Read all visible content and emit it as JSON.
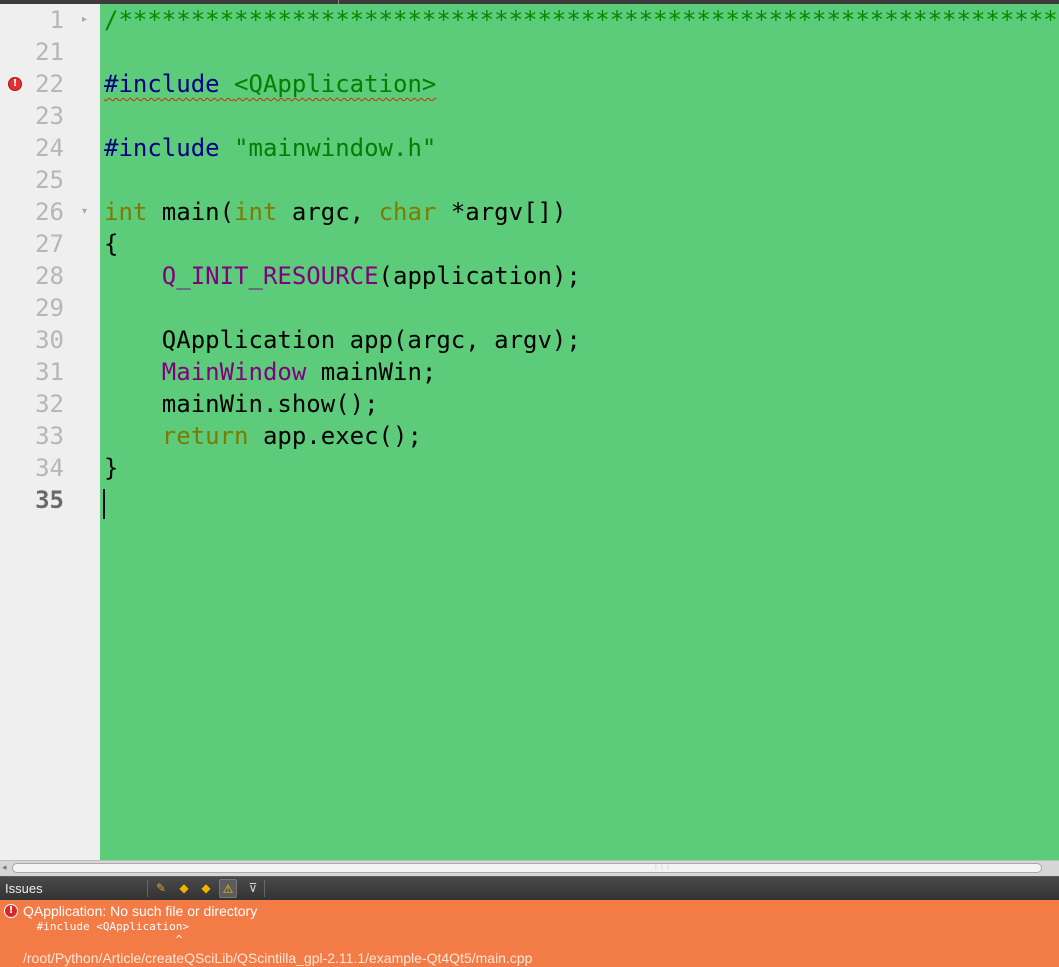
{
  "editor": {
    "colors": {
      "background": "#5ccb7a",
      "gutter": "#efefef",
      "comment": "#008a00",
      "preprocessor": "#000080",
      "string": "#008000",
      "type": "#7e7b00",
      "macro": "#800080"
    },
    "line_numbers": [
      "1",
      "21",
      "22",
      "23",
      "24",
      "25",
      "26",
      "27",
      "28",
      "29",
      "30",
      "31",
      "32",
      "33",
      "34",
      "35"
    ],
    "fold_markers": {
      "line_1": "▸",
      "line_26": "▾"
    },
    "error_marker": "!",
    "code": {
      "l1": "/*****************************************************************",
      "l22_directive": "#include ",
      "l22_header": "<QApplication>",
      "l24_directive": "#include ",
      "l24_string": "\"mainwindow.h\"",
      "l26_int1": "int",
      "l26_mid1": " main(",
      "l26_int2": "int",
      "l26_mid2": " argc, ",
      "l26_char": "char",
      "l26_end": " *argv[])",
      "l27": "{",
      "l28_indent": "    ",
      "l28_macro": "Q_INIT_RESOURCE",
      "l28_end": "(application);",
      "l30": "    QApplication app(argc, argv);",
      "l31_indent": "    ",
      "l31_type": "MainWindow",
      "l31_end": " mainWin;",
      "l32": "    mainWin.show();",
      "l33_indent": "    ",
      "l33_kw": "return",
      "l33_end": " app.exec();",
      "l34": "}"
    }
  },
  "issues": {
    "title": "Issues",
    "toolbar": {
      "clean_icon": "✎",
      "prev_icon": "◆",
      "next_icon": "◆",
      "warning_icon": "⚠",
      "filter_icon": "⊽"
    },
    "colors": {
      "panel": "#f27b46",
      "error": "#d62828"
    },
    "error_icon": "!",
    "message": "QApplication: No such file or directory",
    "context": " #include <QApplication>\n                      ^",
    "path": "/root/Python/Article/createQSciLib/QScintilla_gpl-2.11.1/example-Qt4Qt5/main.cpp"
  },
  "scrollbar": {
    "left_arrow": "◂",
    "grip": "⋮⋮⋮"
  }
}
